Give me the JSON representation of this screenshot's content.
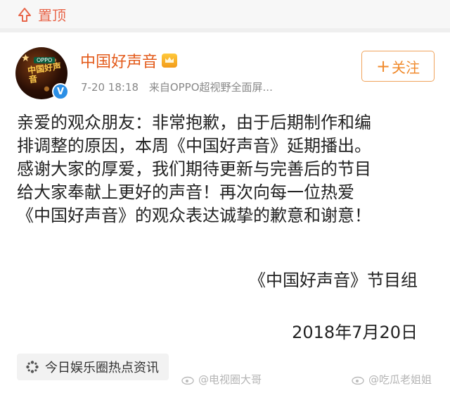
{
  "topbar": {
    "pin_label": "置顶",
    "pin_color": "#e8664a"
  },
  "post": {
    "author_name": "中国好声音",
    "author_color": "#e35a1a",
    "avatar_icon": "voice-of-china-logo",
    "avatar_logo_text": "中国好声音",
    "avatar_brand_text": "OPPO",
    "verified_icon": "verified-v-icon",
    "time": "7-20 18:18",
    "source": "来自OPPO超视野全面屏...",
    "follow_label": "关注",
    "follow_plus": "+",
    "body_lines": [
      "亲爱的观众朋友：非常抱歉，由于后期制作和编",
      "排调整的原因，本周《中国好声音》延期播出。",
      "感谢大家的厚爱，我们期待更新与完善后的节目",
      "给大家奉献上更好的声音！再次向每一位热爱",
      "《中国好声音》的观众表达诚挚的歉意和谢意！"
    ],
    "signature": "《中国好声音》节目组",
    "date": "2018年7月20日",
    "topic_tag": "今日娱乐圈热点资讯"
  },
  "watermarks": [
    "@电视圈大哥",
    "@吃瓜老姐姐"
  ]
}
